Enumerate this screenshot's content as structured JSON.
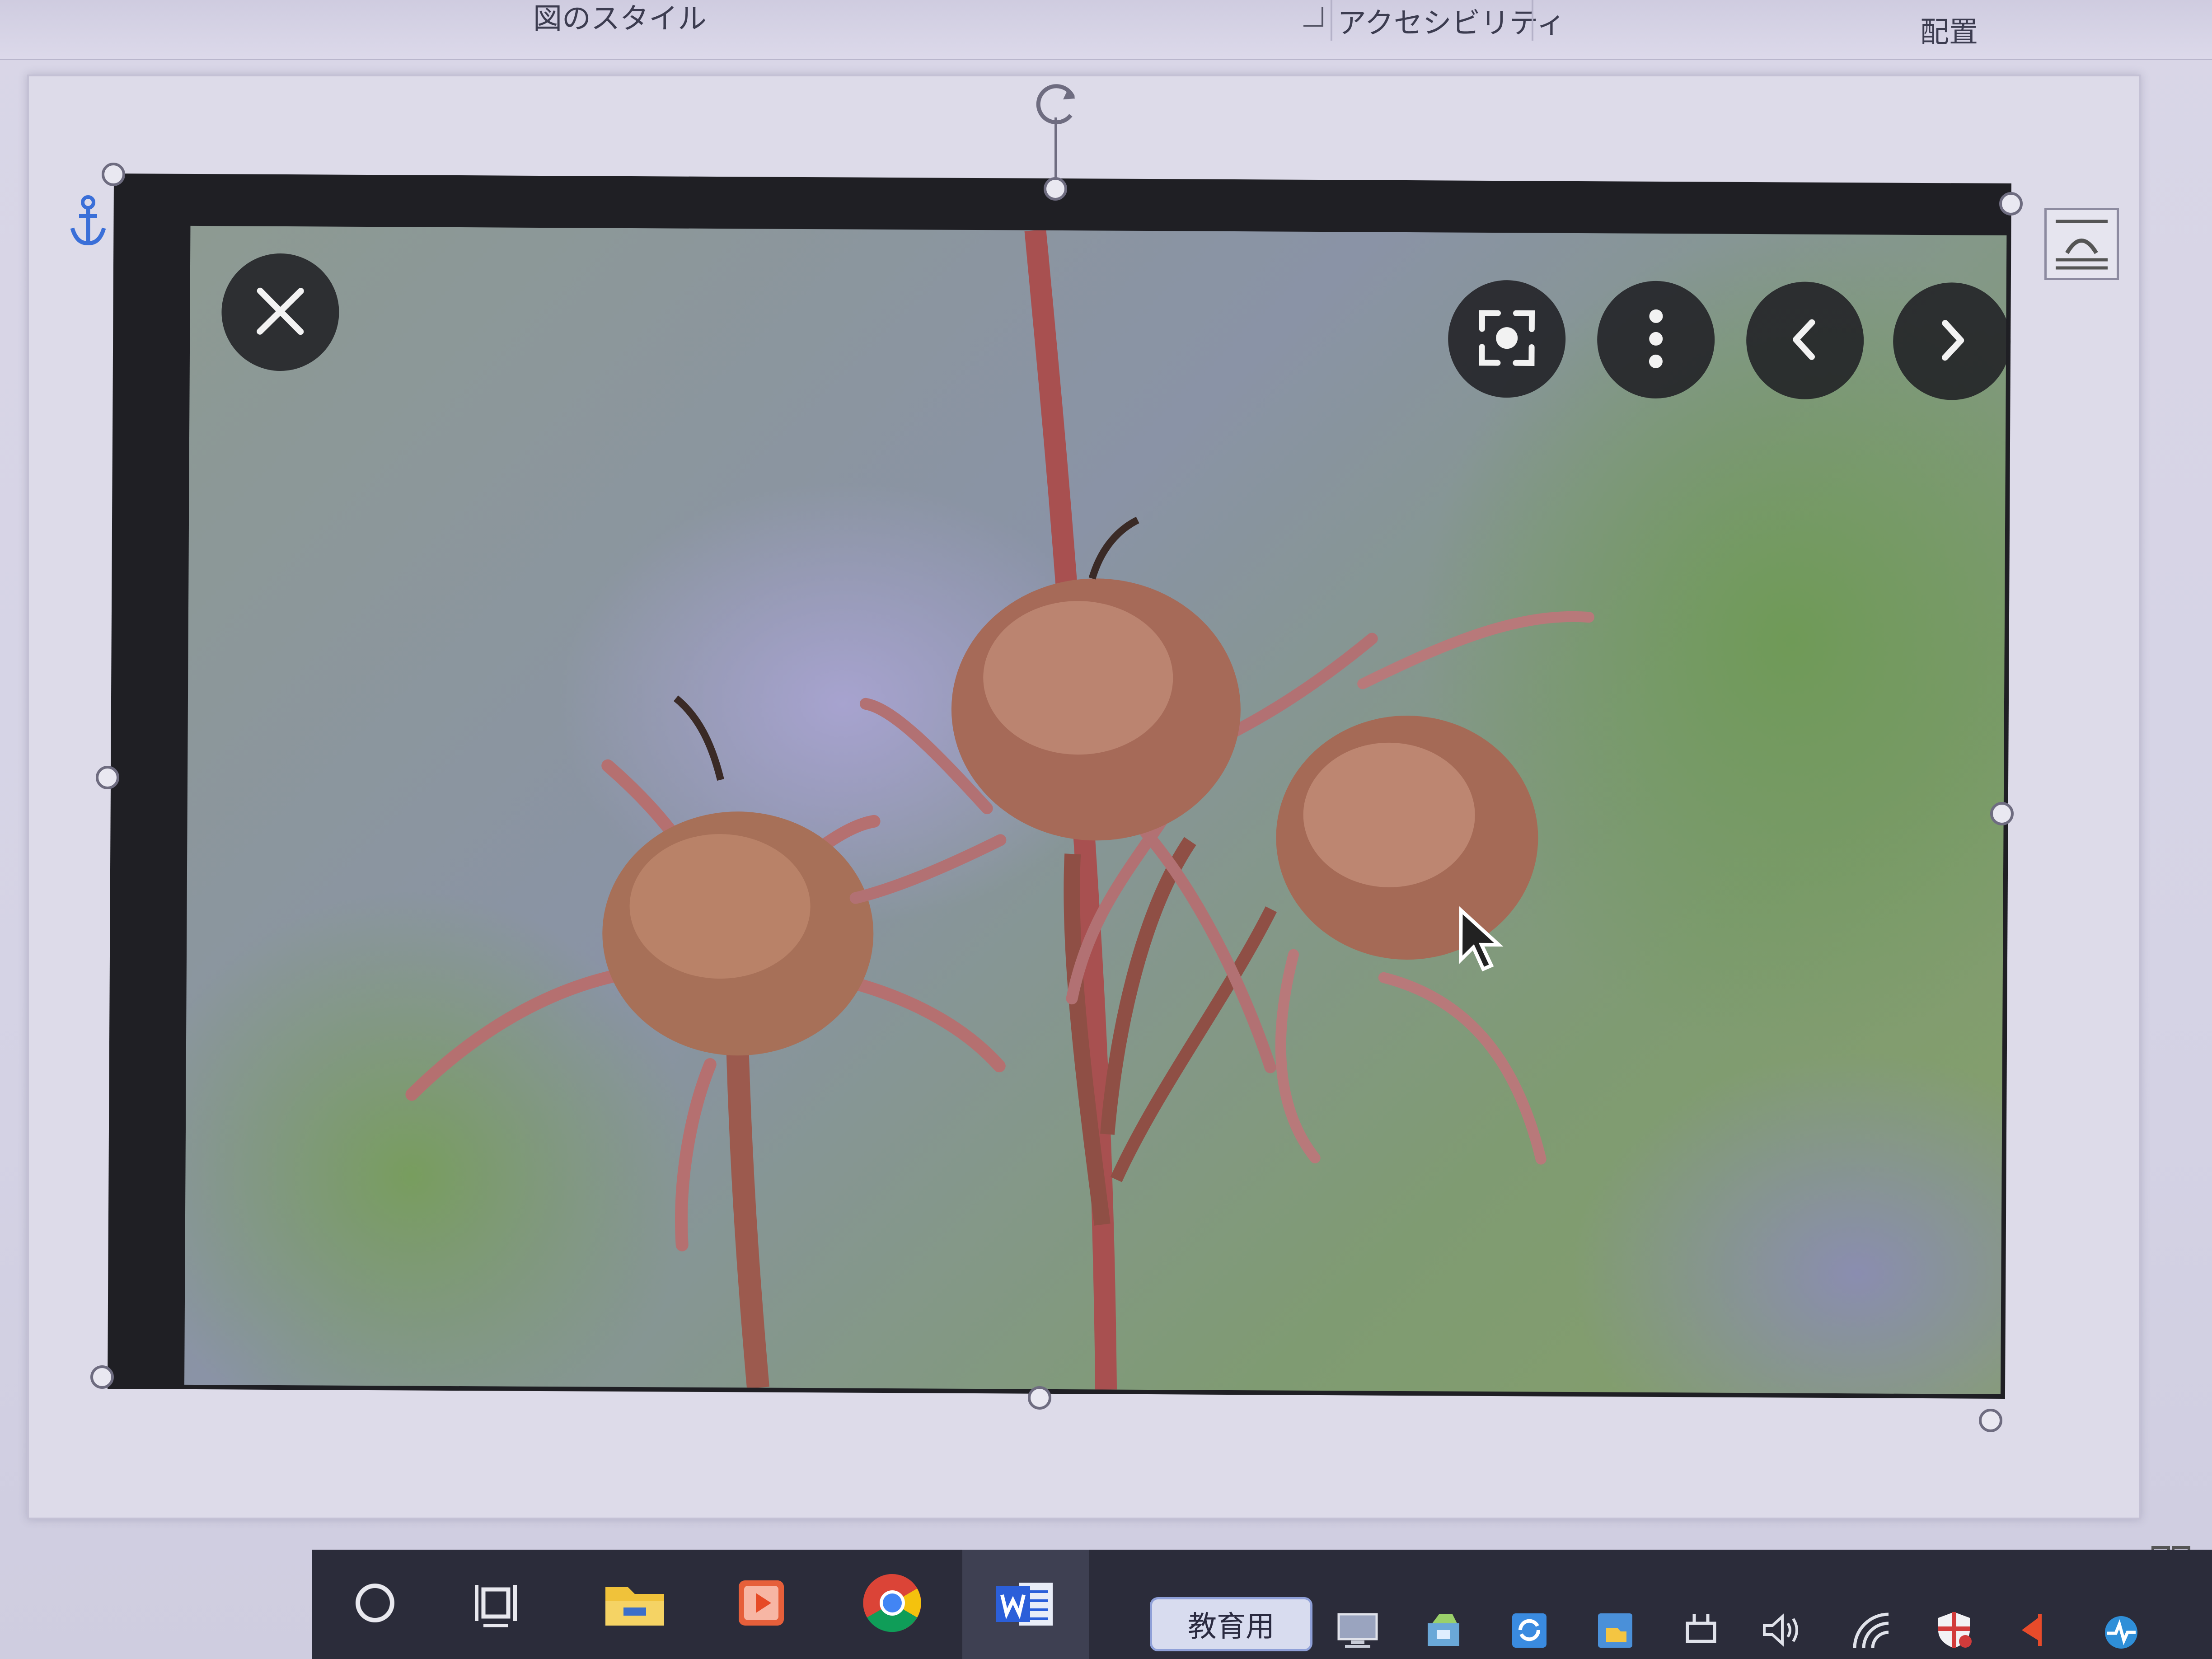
{
  "ribbon": {
    "groups": [
      {
        "label": "図のスタイル"
      },
      {
        "label": "アクセシビリティ"
      },
      {
        "label": "配置"
      }
    ]
  },
  "image_viewer": {
    "buttons": [
      {
        "icon": "close-icon"
      },
      {
        "icon": "visual-search-icon"
      },
      {
        "icon": "more-options-icon"
      },
      {
        "icon": "chevron-left-icon"
      },
      {
        "icon": "chevron-right-icon"
      }
    ]
  },
  "taskbar": {
    "apps": [
      {
        "icon": "search-circle-icon"
      },
      {
        "icon": "task-view-icon"
      },
      {
        "icon": "file-explorer-icon"
      },
      {
        "icon": "media-player-icon"
      },
      {
        "icon": "chrome-icon"
      },
      {
        "icon": "word-icon"
      }
    ],
    "ime_label": "教育用",
    "tray": [
      {
        "icon": "display-icon"
      },
      {
        "icon": "network-share-icon"
      },
      {
        "icon": "sync-icon"
      },
      {
        "icon": "folder-sync-icon"
      },
      {
        "icon": "power-plug-icon"
      },
      {
        "icon": "volume-icon"
      },
      {
        "icon": "wifi-icon"
      },
      {
        "icon": "security-shield-icon"
      },
      {
        "icon": "notification-flag-icon"
      },
      {
        "icon": "activity-monitor-icon"
      }
    ]
  },
  "colors": {
    "ribbon_bg": "#d9d6e7",
    "taskbar_bg": "#2b2c3a",
    "viewer_button_bg": "#202024",
    "handle_stroke": "#6e6c80",
    "word_blue": "#2b5fd9",
    "anchor_blue": "#3a6fd8"
  }
}
